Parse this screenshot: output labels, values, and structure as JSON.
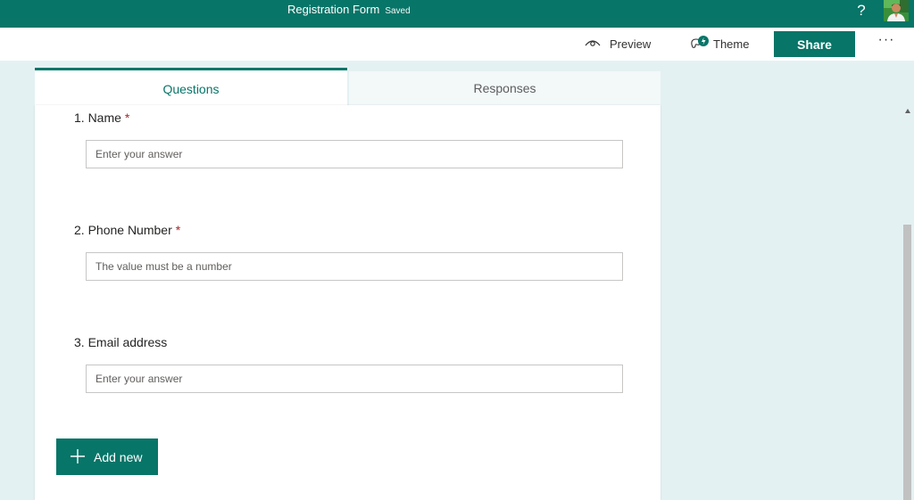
{
  "header": {
    "form_title": "Registration Form",
    "save_status": "Saved",
    "help_label": "?"
  },
  "commands": {
    "preview": "Preview",
    "theme": "Theme",
    "share": "Share",
    "more": "···"
  },
  "tabs": [
    {
      "label": "Questions",
      "active": true
    },
    {
      "label": "Responses",
      "active": false
    }
  ],
  "questions": [
    {
      "label": "1. Name",
      "required": "*",
      "placeholder": "Enter your answer"
    },
    {
      "label": "2. Phone Number",
      "required": "*",
      "placeholder": "The value must be a number"
    },
    {
      "label": "3. Email address",
      "required": "",
      "placeholder": "Enter your answer"
    }
  ],
  "add_new": "Add new",
  "colors": {
    "brand": "#077568",
    "background": "#e4f1f3",
    "required": "#a4262c"
  },
  "icons": {
    "preview": "eye-icon",
    "theme": "palette-icon",
    "add": "plus-icon",
    "more": "ellipsis-icon"
  }
}
